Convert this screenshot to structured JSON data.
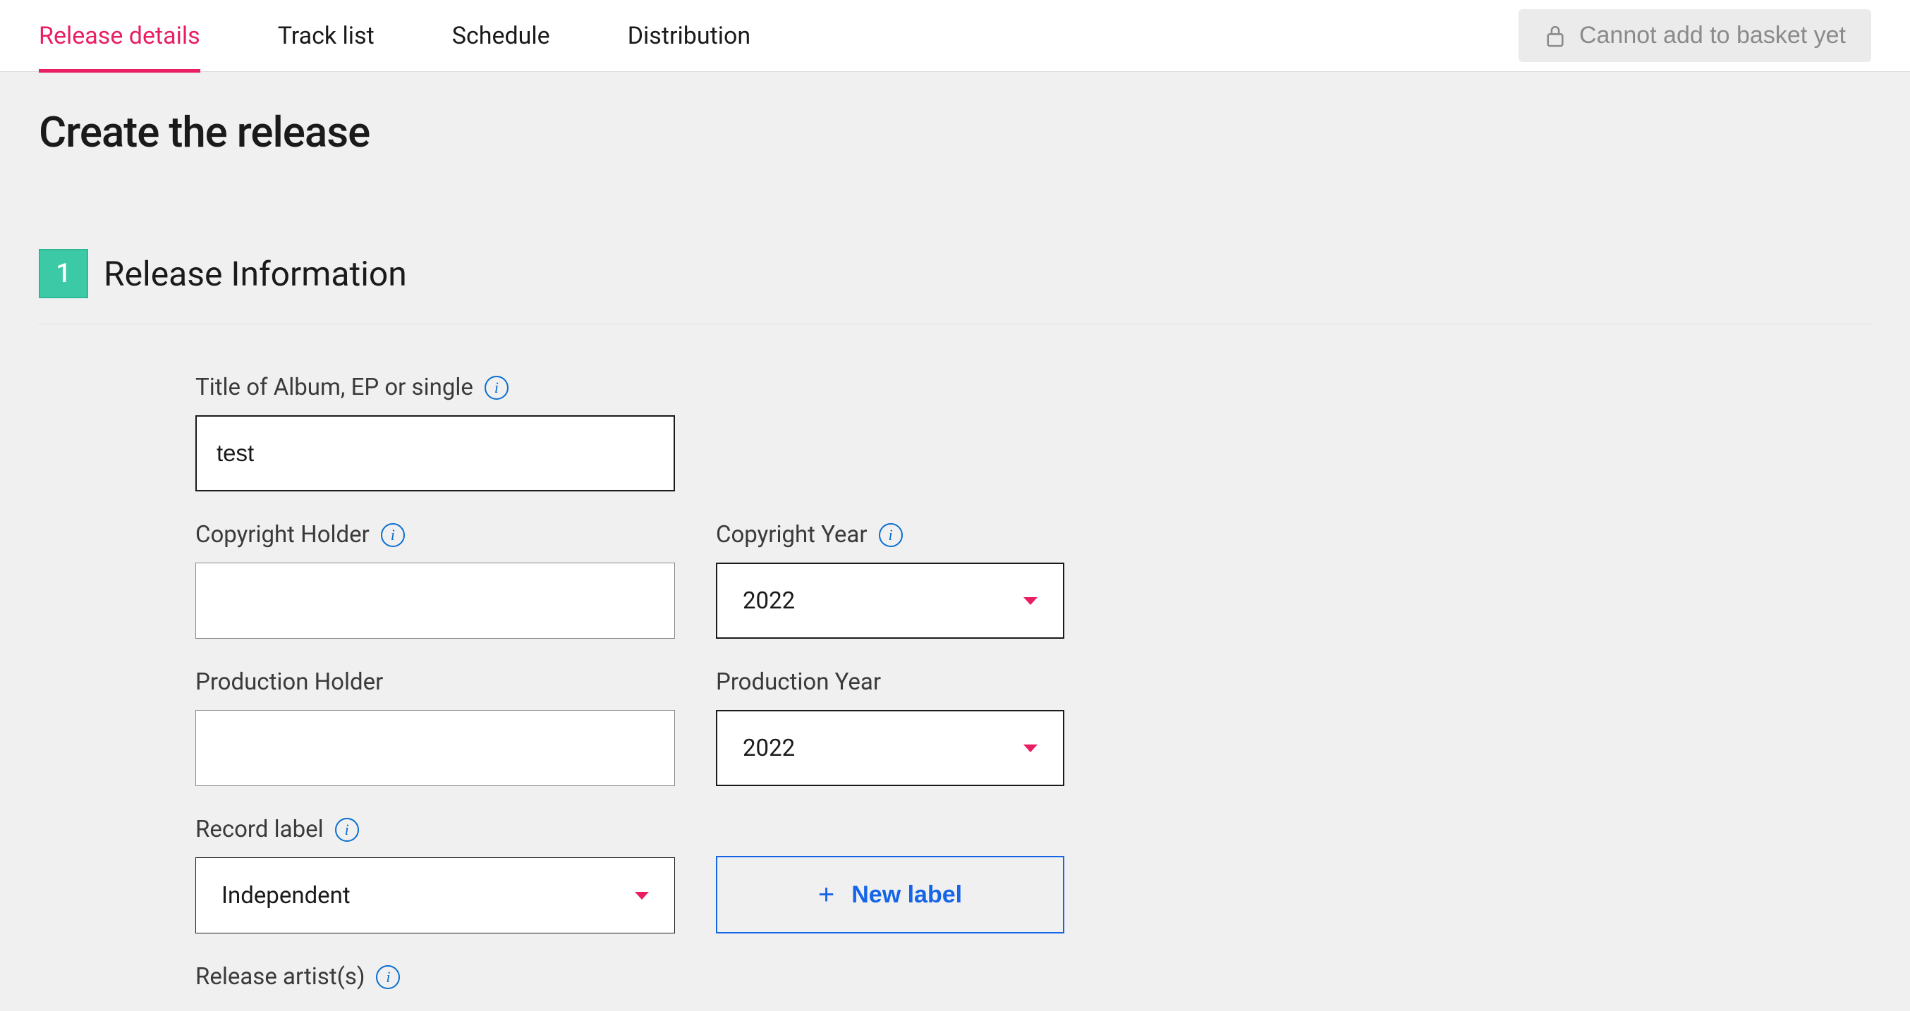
{
  "tabs": {
    "release_details": "Release details",
    "track_list": "Track list",
    "schedule": "Schedule",
    "distribution": "Distribution"
  },
  "basket_button": "Cannot add to basket yet",
  "page_title": "Create the release",
  "section": {
    "step": "1",
    "title": "Release Information"
  },
  "form": {
    "title_label": "Title of Album, EP or single",
    "title_value": "test",
    "copyright_holder_label": "Copyright Holder",
    "copyright_holder_value": "",
    "copyright_year_label": "Copyright Year",
    "copyright_year_value": "2022",
    "production_holder_label": "Production Holder",
    "production_holder_value": "",
    "production_year_label": "Production Year",
    "production_year_value": "2022",
    "record_label_label": "Record label",
    "record_label_value": "Independent",
    "new_label_button": "New label",
    "release_artists_label": "Release artist(s)"
  }
}
